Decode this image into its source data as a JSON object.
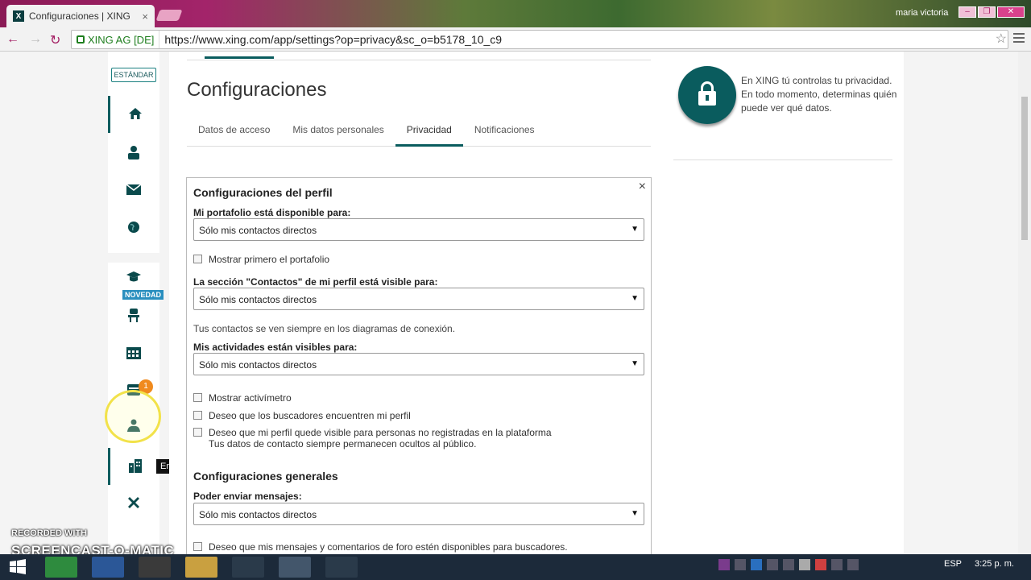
{
  "browser": {
    "tab_title": "Configuraciones | XING",
    "tab_icon": "X",
    "user": "maria victoria",
    "security_label": "XING AG [DE]",
    "url": "https://www.xing.com/app/settings?op=privacy&sc_o=b5178_10_c9"
  },
  "sidebar": {
    "badge": "ESTÁNDAR",
    "novedad": "NOVEDAD",
    "notification_count": "1",
    "tooltip": "Empresas",
    "items": [
      {
        "name": "home-icon",
        "glyph": "⌂"
      },
      {
        "name": "profile-icon",
        "glyph": "♟"
      },
      {
        "name": "mail-icon",
        "glyph": "✉"
      },
      {
        "name": "globe-icon",
        "glyph": "●"
      },
      {
        "name": "graduation-cap-icon",
        "glyph": "🎓"
      },
      {
        "name": "chair-icon",
        "glyph": "⑁"
      },
      {
        "name": "calendar-icon",
        "glyph": "▦"
      },
      {
        "name": "jobs-icon",
        "glyph": "▤"
      },
      {
        "name": "contacts-icon",
        "glyph": "♙"
      },
      {
        "name": "companies-icon",
        "glyph": "▥"
      },
      {
        "name": "tools-icon",
        "glyph": "✖"
      }
    ]
  },
  "main": {
    "title": "Configuraciones",
    "tabs": [
      {
        "label": "Datos de acceso"
      },
      {
        "label": "Mis datos personales"
      },
      {
        "label": "Privacidad",
        "active": true
      },
      {
        "label": "Notificaciones"
      }
    ],
    "card": {
      "close": "×",
      "profile_title": "Configuraciones del perfil",
      "portfolio_label": "Mi portafolio está disponible para:",
      "portfolio_value": "Sólo mis contactos directos",
      "show_portfolio_first": "Mostrar primero el portafolio",
      "contacts_label": "La sección \"Contactos\" de mi perfil está visible para:",
      "contacts_value": "Sólo mis contactos directos",
      "contacts_hint": "Tus contactos se ven siempre en los diagramas de conexión.",
      "activities_label": "Mis actividades están visibles para:",
      "activities_value": "Sólo mis contactos directos",
      "show_activity_meter": "Mostrar activímetro",
      "search_engines": "Deseo que los buscadores encuentren mi perfil",
      "public_profile": "Deseo que mi perfil quede visible para personas no registradas en la plataforma",
      "public_profile_note": "Tus datos de contacto siempre permanecen ocultos al público.",
      "general_title": "Configuraciones generales",
      "messages_label": "Poder enviar mensajes:",
      "messages_value": "Sólo mis contactos directos",
      "forum_search": "Deseo que mis mensajes y comentarios de foro estén disponibles para buscadores."
    }
  },
  "aside": {
    "text": "En XING tú controlas tu privacidad. En todo momento, determinas quién puede ver qué datos."
  },
  "watermark": {
    "line1": "RECORDED WITH",
    "line2": "SCREENCAST-O-MATIC"
  },
  "taskbar": {
    "language": "ESP",
    "time": "3:25 p. m."
  },
  "colors": {
    "xing_teal": "#0a5c5e",
    "badge_blue": "#2a8fbf",
    "notification_orange": "#f08a1e"
  }
}
